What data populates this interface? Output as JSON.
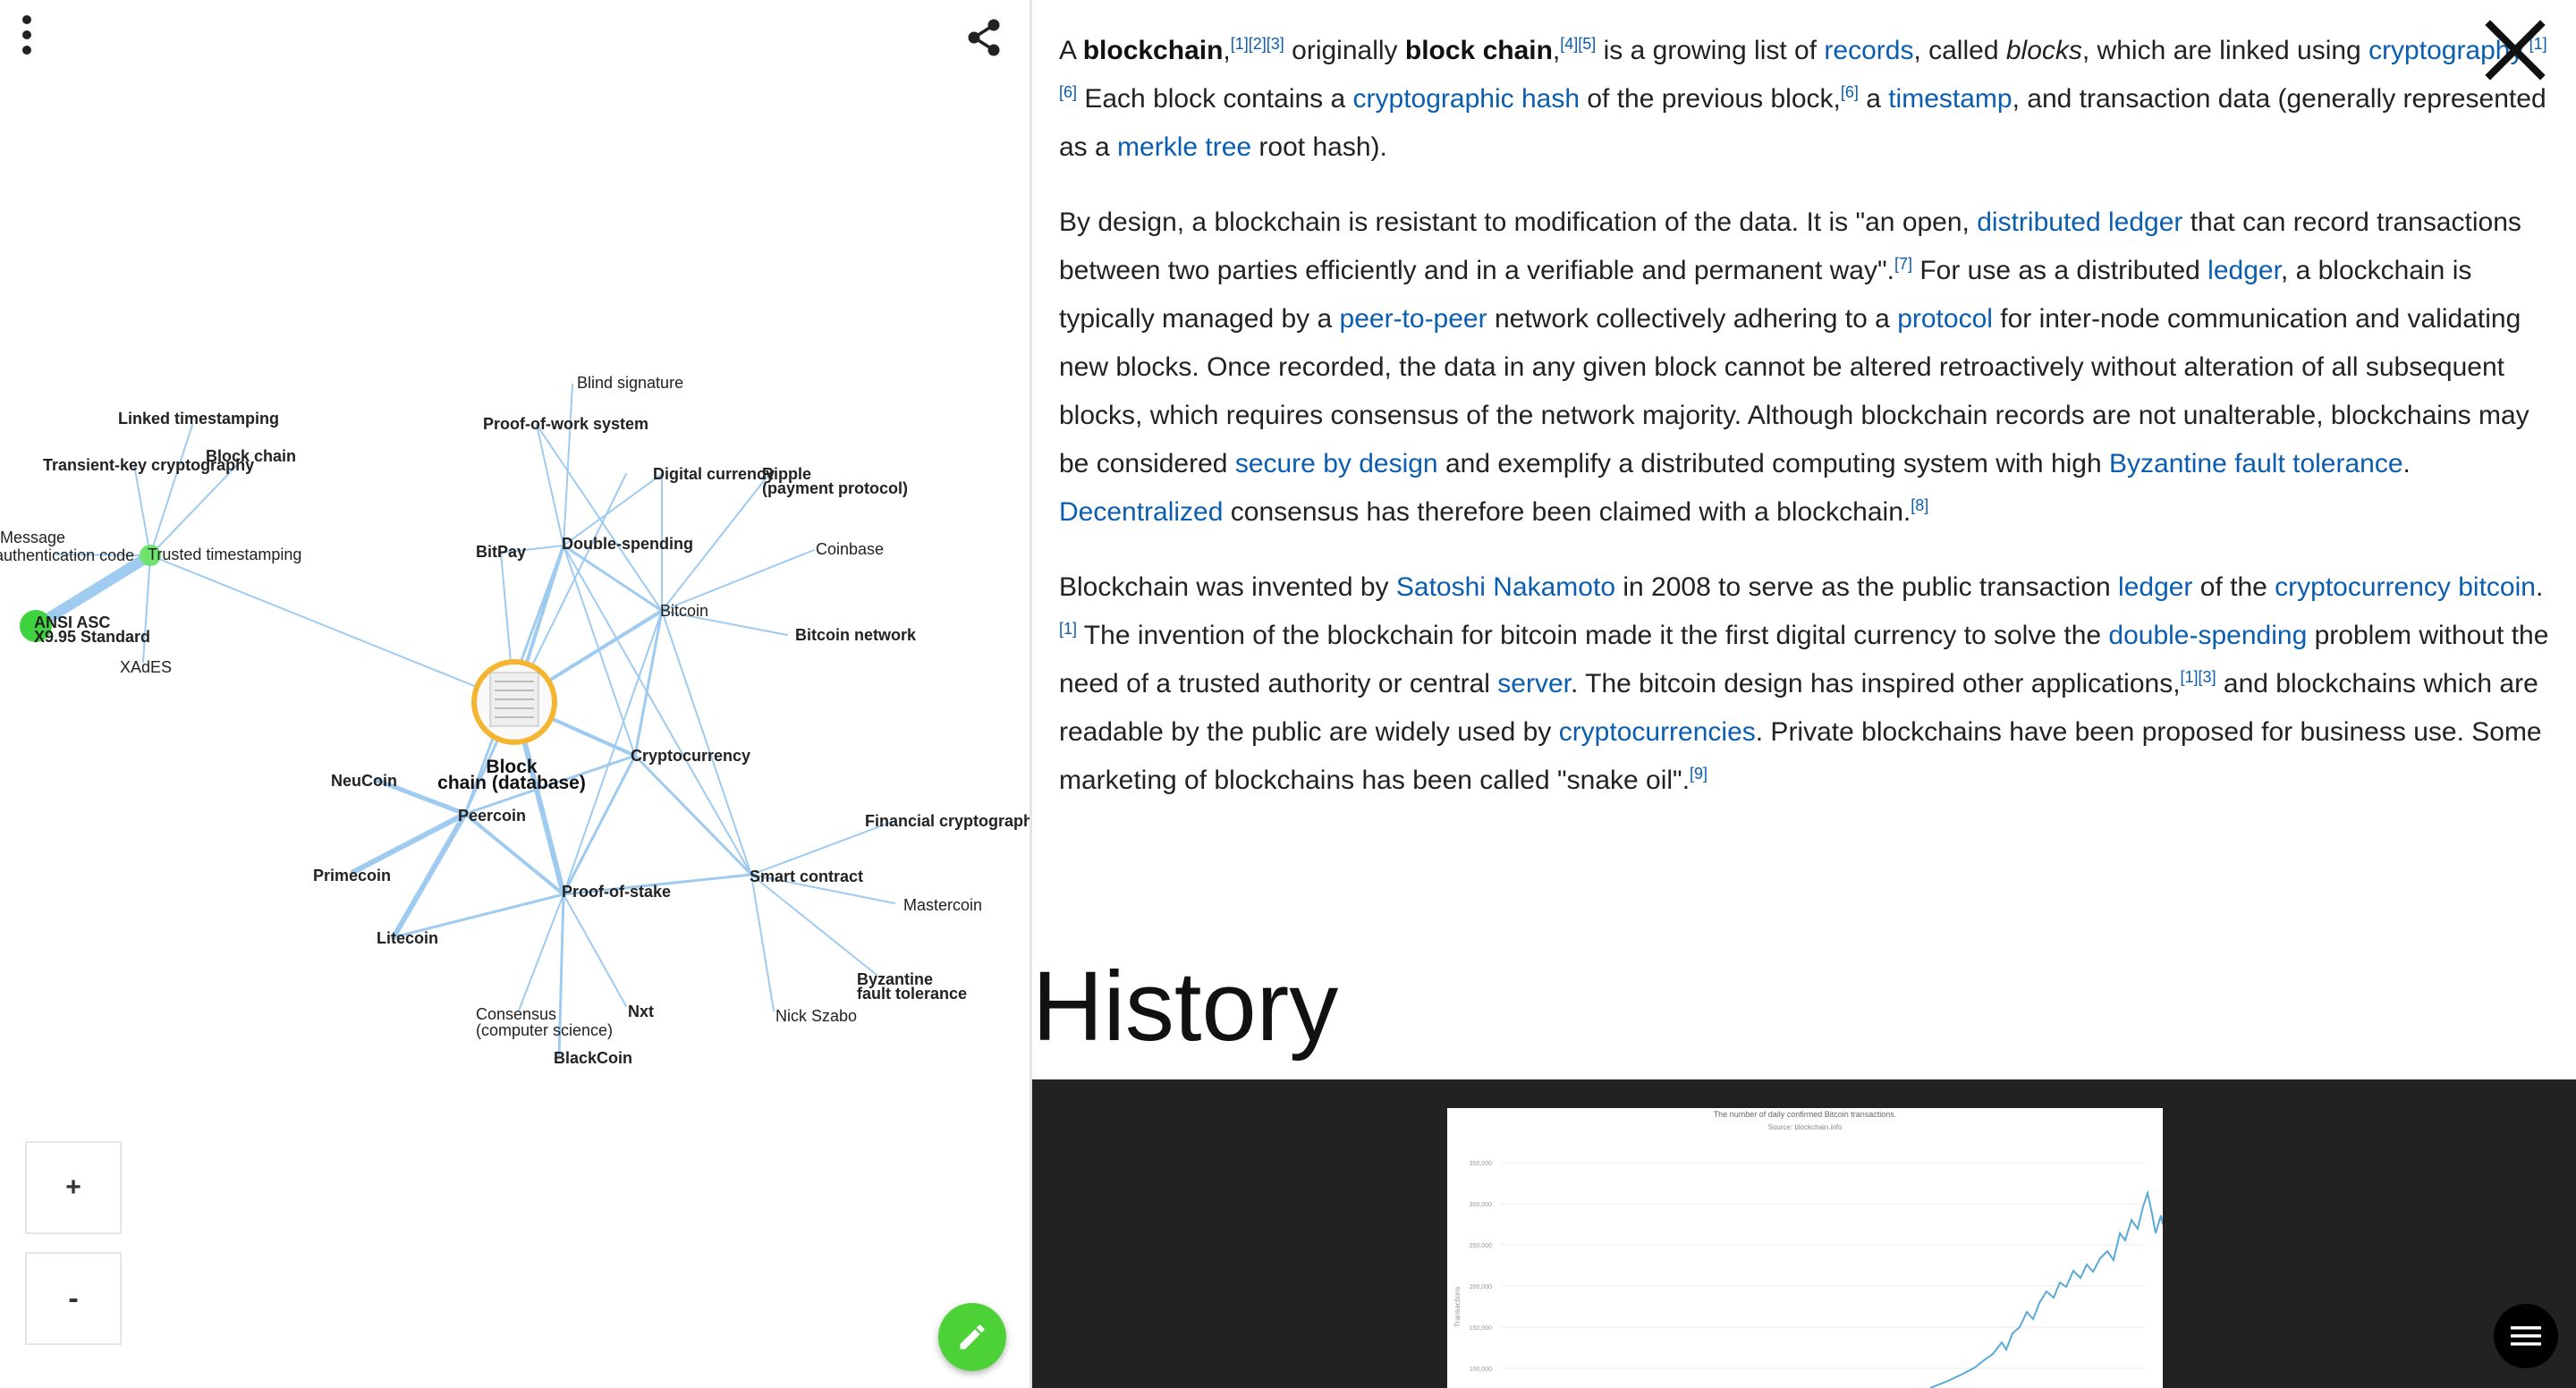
{
  "graph": {
    "center_label_line1": "Block",
    "center_label_line2": "chain (database)",
    "zoom_in_label": "+",
    "zoom_out_label": "-",
    "accent_color": "#4cd137",
    "highlight_ring_color": "#f5b530",
    "edge_color": "#9ecbef",
    "nodes": [
      "Linked timestamping",
      "Transient-key cryptography",
      "Block chain",
      "Message",
      "authentication code",
      "Trusted timestamping",
      "ANSI ASC",
      "X9.95 Standard",
      "XAdES",
      "Blind signature",
      "Proof-of-work system",
      "Digital currency",
      "Ripple",
      "(payment protocol)",
      "Coinbase",
      "BitPay",
      "Double-spending",
      "Bitcoin",
      "Bitcoin network",
      "Cryptocurrency",
      "NeuCoin",
      "Peercoin",
      "Financial cryptography",
      "Primecoin",
      "Smart contract",
      "Proof-of-stake",
      "Mastercoin",
      "Litecoin",
      "Byzantine",
      "fault tolerance",
      "Consensus",
      "(computer science)",
      "Nxt",
      "Nick Szabo",
      "BlackCoin"
    ]
  },
  "article": {
    "p1": {
      "s1": "A ",
      "b1": "blockchain",
      "s2": ",",
      "ref1": "[1][2][3]",
      "s3": " originally ",
      "b2": "block chain",
      "s4": ",",
      "ref2": "[4][5]",
      "s5": " is a growing list of ",
      "l1": "records",
      "s6": ", called ",
      "i1": "blocks",
      "s7": ", which are linked using ",
      "l2": "cryptography",
      "s8": ".",
      "ref3": "[1][6]",
      "s9": " Each block contains a ",
      "l3": "cryptographic hash",
      "s10": " of the previous block,",
      "ref4": "[6]",
      "s11": " a ",
      "l4": "timestamp",
      "s12": ", and transaction data (generally represented as a ",
      "l5": "merkle tree",
      "s13": " root hash)."
    },
    "p2": {
      "s1": "By design, a blockchain is resistant to modification of the data. It is \"an open, ",
      "l1": "distributed ledger",
      "s2": " that can record transactions between two parties efficiently and in a verifiable and permanent way\".",
      "ref1": "[7]",
      "s3": " For use as a distributed ",
      "l2": "ledger",
      "s4": ", a blockchain is typically managed by a ",
      "l3": "peer-to-peer",
      "s5": " network collectively adhering to a ",
      "l4": "protocol",
      "s6": " for inter-node communication and validating new blocks. Once recorded, the data in any given block cannot be altered retroactively without alteration of all subsequent blocks, which requires consensus of the network majority. Although blockchain records are not unalterable, blockchains may be considered ",
      "l5": "secure by design",
      "s7": " and exemplify a distributed computing system with high ",
      "l6": "Byzantine fault tolerance",
      "s8": ". ",
      "l7": "Decentralized",
      "s9": " consensus has therefore been claimed with a blockchain.",
      "ref2": "[8]"
    },
    "p3": {
      "s1": "Blockchain was invented by ",
      "l1": "Satoshi Nakamoto",
      "s2": " in 2008 to serve as the public transaction ",
      "l2": "ledger",
      "s3": " of the ",
      "l3": "cryptocurrency bitcoin",
      "s4": ".",
      "ref1": "[1]",
      "s5": " The invention of the blockchain for bitcoin made it the first digital currency to solve the ",
      "l4": "double-spending",
      "s6": " problem without the need of a trusted authority or central ",
      "l5": "server",
      "s7": ". The bitcoin design has inspired other applications,",
      "ref2": "[1][3]",
      "s8": " and blockchains which are readable by the public are widely used by ",
      "l6": "cryptocurrencies",
      "s9": ". Private blockchains have been proposed for business use. Some marketing of blockchains has been called \"snake oil\".",
      "ref3": "[9]"
    },
    "history_heading": "History",
    "figure": {
      "title": "The number of daily confirmed Bitcoin transactions.",
      "source": "Source: blockchain.info",
      "ylabel": "Transactions",
      "y_ticks": [
        "350,000",
        "300,000",
        "250,000",
        "200,000",
        "150,000",
        "100,000"
      ]
    }
  },
  "icons": {
    "menu": "vertical-dots-icon",
    "share": "share-icon",
    "close": "close-icon",
    "edit": "pencil-icon",
    "toc": "hamburger-icon"
  }
}
